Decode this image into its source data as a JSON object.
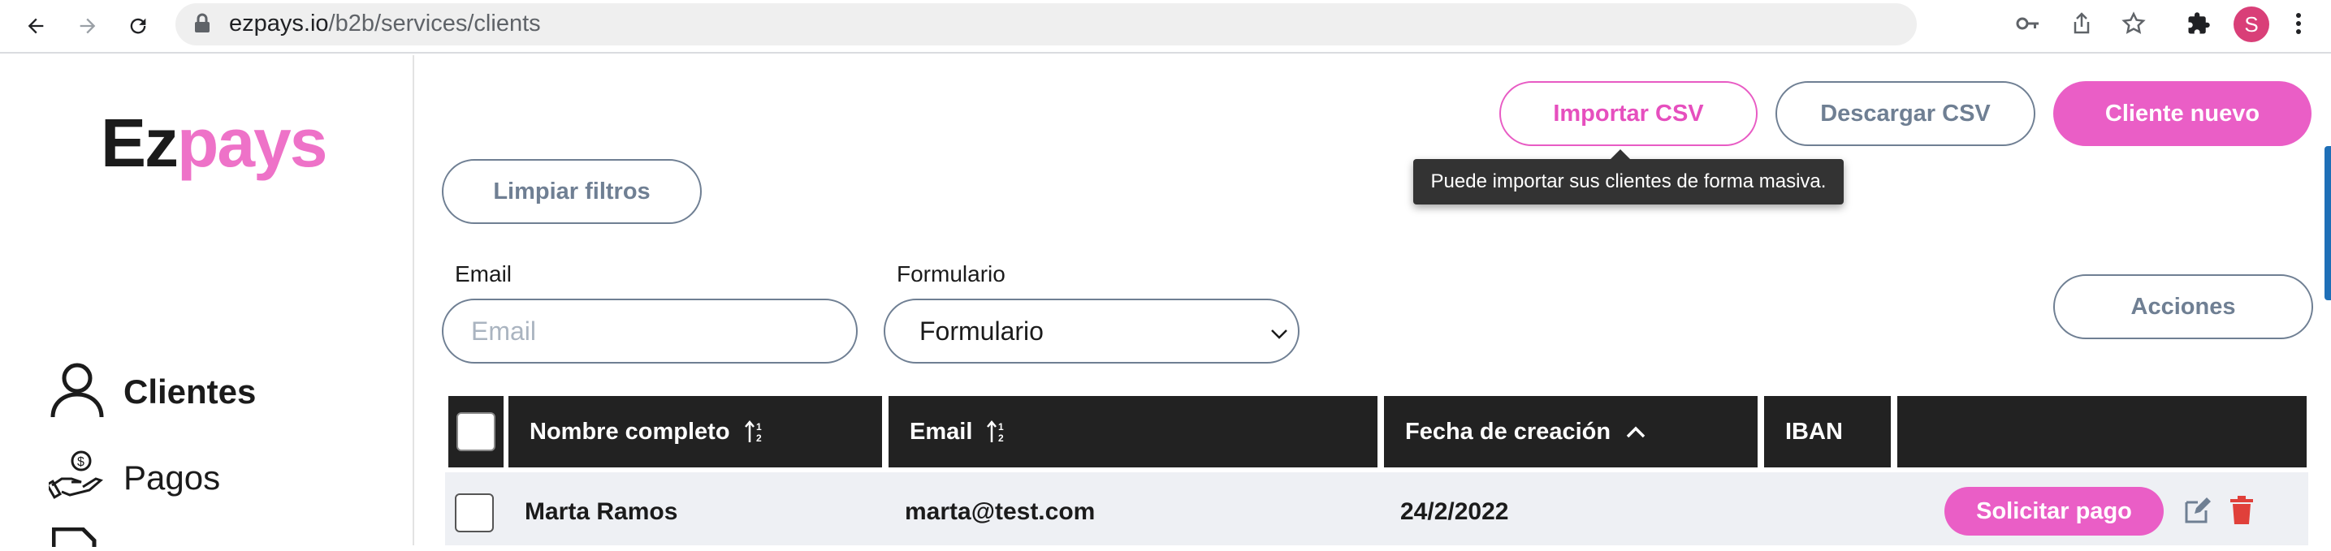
{
  "browser": {
    "url_host": "ezpays.io",
    "url_path": "/b2b/services/clients",
    "profile_initial": "S"
  },
  "brand": {
    "logo_part1": "Ez",
    "logo_part2": "pays"
  },
  "sidebar": {
    "items": [
      {
        "label": "Clientes",
        "icon": "user-icon",
        "active": true
      },
      {
        "label": "Pagos",
        "icon": "payment-hand-icon",
        "active": false
      }
    ]
  },
  "toolbar": {
    "import_label": "Importar CSV",
    "download_label": "Descargar CSV",
    "new_client_label": "Cliente nuevo",
    "clear_filters_label": "Limpiar filtros",
    "actions_label": "Acciones",
    "import_tooltip": "Puede importar sus clientes de forma masiva."
  },
  "filters": {
    "email_label": "Email",
    "email_placeholder": "Email",
    "form_label": "Formulario",
    "form_selected": "Formulario"
  },
  "table": {
    "columns": [
      "Nombre completo",
      "Email",
      "Fecha de creación",
      "IBAN"
    ],
    "rows": [
      {
        "name": "Marta Ramos",
        "email": "marta@test.com",
        "created": "24/2/2022",
        "iban": "",
        "action_label": "Solicitar pago"
      }
    ]
  },
  "colors": {
    "accent": "#ea5ec6",
    "outline_gray": "#6f7f93",
    "header_dark": "#222222",
    "delete_red": "#e0403a"
  }
}
